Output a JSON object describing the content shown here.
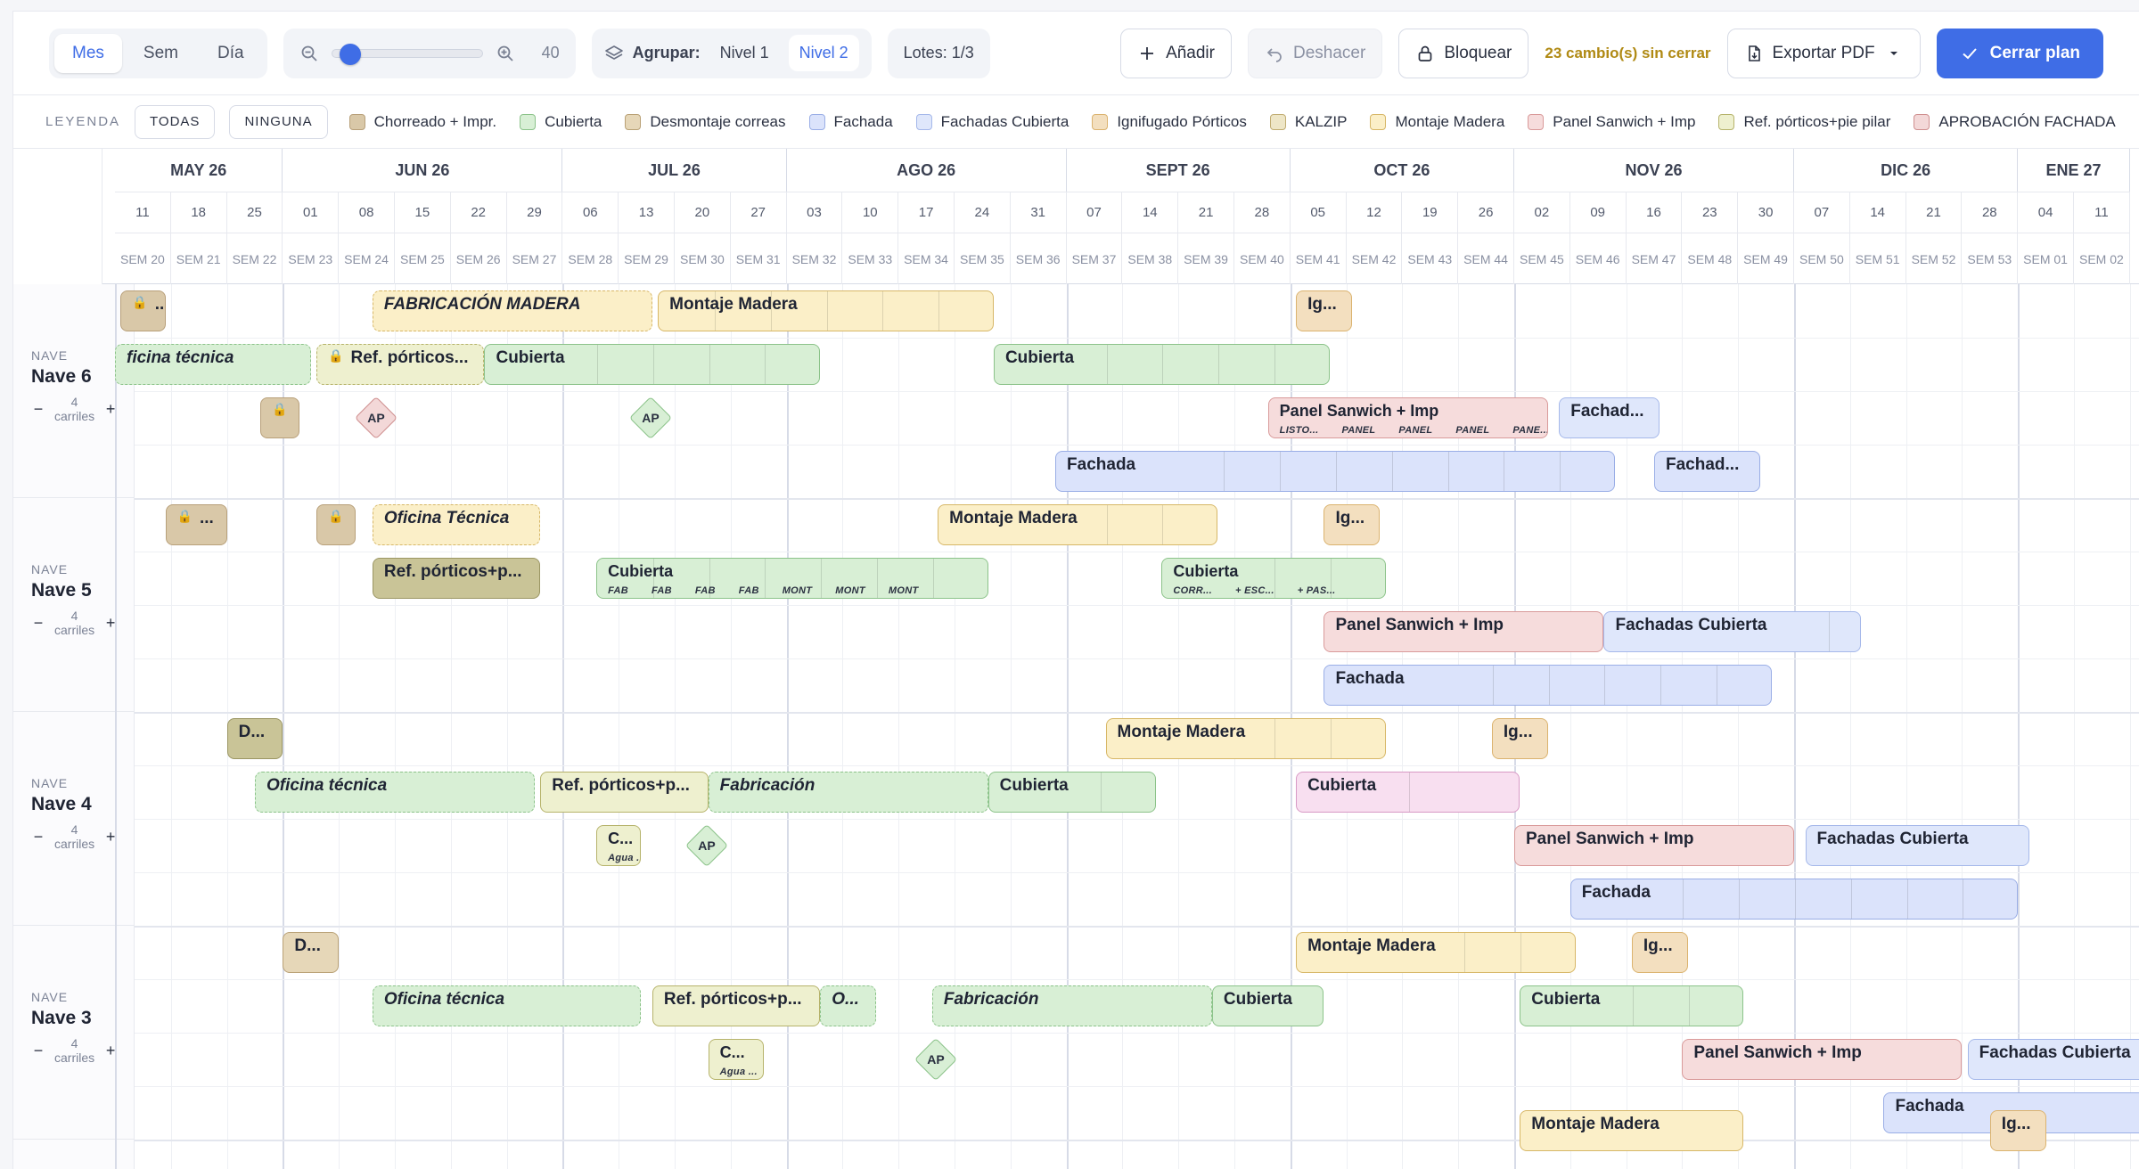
{
  "toolbar": {
    "view_modes": [
      {
        "label": "Mes",
        "active": true
      },
      {
        "label": "Sem",
        "active": false
      },
      {
        "label": "Día",
        "active": false
      }
    ],
    "zoom_value": "40",
    "zoom_level_fraction": 0.05,
    "group_label": "Agrupar:",
    "group_levels": [
      {
        "label": "Nivel 1",
        "active": false
      },
      {
        "label": "Nivel 2",
        "active": true
      }
    ],
    "lotes_label": "Lotes: 1/3",
    "add_label": "Añadir",
    "undo_label": "Deshacer",
    "lock_label": "Bloquear",
    "unsaved_text": "23 cambio(s) sin cerrar",
    "export_label": "Exportar PDF",
    "close_plan_label": "Cerrar plan"
  },
  "legend": {
    "title": "LEYENDA",
    "all_label": "TODAS",
    "none_label": "NINGUNA",
    "items": [
      {
        "label": "Chorreado + Impr.",
        "color": "#d9c8a8",
        "border": "#b8a07a"
      },
      {
        "label": "Cubierta",
        "color": "#d8efd5",
        "border": "#8cc38a"
      },
      {
        "label": "Desmontaje correas",
        "color": "#e6d7b8",
        "border": "#b9a176"
      },
      {
        "label": "Fachada",
        "color": "#dbe3fb",
        "border": "#9aaee6"
      },
      {
        "label": "Fachadas Cubierta",
        "color": "#dfe7fb",
        "border": "#a5b8ea"
      },
      {
        "label": "Ignifugado Pórticos",
        "color": "#f3dfbf",
        "border": "#dbb36f"
      },
      {
        "label": "KALZIP",
        "color": "#eee6c7",
        "border": "#c1ad72"
      },
      {
        "label": "Montaje Madera",
        "color": "#fbefc8",
        "border": "#d7b767"
      },
      {
        "label": "Panel Sanwich + Imp",
        "color": "#f6dcdc",
        "border": "#d99a9a"
      },
      {
        "label": "Ref. pórticos+pie pilar",
        "color": "#eef0cf",
        "border": "#b6b36b"
      },
      {
        "label": "APROBACIÓN FACHADA",
        "color": "#f3d8d8",
        "border": "#cf8f8f"
      }
    ]
  },
  "timeline": {
    "months": [
      "MAY 26",
      "JUN 26",
      "JUL 26",
      "AGO 26",
      "SEPT 26",
      "OCT 26",
      "NOV 26",
      "DIC 26",
      "ENE 27"
    ],
    "days": [
      "11",
      "18",
      "25",
      "01",
      "08",
      "15",
      "22",
      "29",
      "06",
      "13",
      "20",
      "27",
      "03",
      "10",
      "17",
      "24",
      "31",
      "07",
      "14",
      "21",
      "28",
      "05",
      "12",
      "19",
      "26",
      "02",
      "09",
      "16",
      "23",
      "30",
      "07",
      "14",
      "21",
      "28",
      "04",
      "11"
    ],
    "weeks": [
      "SEM 20",
      "SEM 21",
      "SEM 22",
      "SEM 23",
      "SEM 24",
      "SEM 25",
      "SEM 26",
      "SEM 27",
      "SEM 28",
      "SEM 29",
      "SEM 30",
      "SEM 31",
      "SEM 32",
      "SEM 33",
      "SEM 34",
      "SEM 35",
      "SEM 36",
      "SEM 37",
      "SEM 38",
      "SEM 39",
      "SEM 40",
      "SEM 41",
      "SEM 42",
      "SEM 43",
      "SEM 44",
      "SEM 45",
      "SEM 46",
      "SEM 47",
      "SEM 48",
      "SEM 49",
      "SEM 50",
      "SEM 51",
      "SEM 52",
      "SEM 53",
      "SEM 01",
      "SEM 02"
    ]
  },
  "naves": [
    {
      "kicker": "NAVE",
      "name": "Nave 6",
      "lanes_count": "4",
      "lanes_label": "carriles"
    },
    {
      "kicker": "NAVE",
      "name": "Nave 5",
      "lanes_count": "4",
      "lanes_label": "carriles"
    },
    {
      "kicker": "NAVE",
      "name": "Nave 4",
      "lanes_count": "4",
      "lanes_label": "carriles"
    },
    {
      "kicker": "NAVE",
      "name": "Nave 3",
      "lanes_count": "4",
      "lanes_label": "carriles"
    }
  ],
  "bars": [
    {
      "nave": 0,
      "lane": 0,
      "start": 0.1,
      "weeks": 0.8,
      "label": "...",
      "type": "Chorreado + Impr.",
      "locked": true
    },
    {
      "nave": 0,
      "lane": 0,
      "start": 4.6,
      "weeks": 5.0,
      "label": "FABRICACIÓN MADERA",
      "type": "Montaje Madera",
      "italic": true,
      "dashed": true
    },
    {
      "nave": 0,
      "lane": 0,
      "start": 9.7,
      "weeks": 6.0,
      "label": "Montaje Madera",
      "type": "Montaje Madera",
      "segments": [
        1,
        2,
        3,
        4,
        5
      ]
    },
    {
      "nave": 0,
      "lane": 0,
      "start": 21.1,
      "weeks": 1.0,
      "label": "Ig...",
      "type": "Ignifugado Pórticos"
    },
    {
      "nave": 0,
      "lane": 1,
      "start": 0.0,
      "weeks": 3.5,
      "label": "ficina técnica",
      "type": "Cubierta",
      "italic": true,
      "dashed": true
    },
    {
      "nave": 0,
      "lane": 1,
      "start": 3.6,
      "weeks": 3.0,
      "label": "Ref. pórticos...",
      "type": "Ref. pórticos+pie pilar",
      "locked": true,
      "dashed": true
    },
    {
      "nave": 0,
      "lane": 1,
      "start": 6.6,
      "weeks": 6.0,
      "label": "Cubierta",
      "type": "Cubierta",
      "segments": [
        2,
        3,
        4,
        5
      ]
    },
    {
      "nave": 0,
      "lane": 1,
      "start": 15.7,
      "weeks": 6.0,
      "label": "Cubierta",
      "type": "Cubierta",
      "segments": [
        2,
        3,
        4,
        5
      ]
    },
    {
      "nave": 0,
      "lane": 2,
      "start": 2.6,
      "weeks": 0.7,
      "label": "",
      "type": "Chorreado + Impr.",
      "locked": true
    },
    {
      "nave": 0,
      "lane": 2,
      "start": 20.6,
      "weeks": 5.0,
      "label": "Panel Sanwich + Imp",
      "type": "Panel Sanwich + Imp",
      "subs": [
        "LISTO...",
        "PANEL",
        "PANEL",
        "PANEL",
        "PANE..."
      ]
    },
    {
      "nave": 0,
      "lane": 2,
      "start": 25.8,
      "weeks": 1.8,
      "label": "Fachad...",
      "type": "Fachadas Cubierta"
    },
    {
      "nave": 0,
      "lane": 3,
      "start": 16.8,
      "weeks": 10.0,
      "label": "Fachada",
      "type": "Fachada",
      "segments": [
        3,
        4,
        5,
        6,
        7,
        8,
        9
      ]
    },
    {
      "nave": 0,
      "lane": 3,
      "start": 27.5,
      "weeks": 1.9,
      "label": "Fachad...",
      "type": "Fachada"
    },
    {
      "nave": 1,
      "lane": 0,
      "start": 0.9,
      "weeks": 1.1,
      "label": "...",
      "type": "Chorreado + Impr.",
      "locked": true
    },
    {
      "nave": 1,
      "lane": 0,
      "start": 3.6,
      "weeks": 0.7,
      "label": "",
      "type": "Chorreado + Impr.",
      "locked": true
    },
    {
      "nave": 1,
      "lane": 0,
      "start": 4.6,
      "weeks": 3.0,
      "label": "Oficina Técnica",
      "type": "Montaje Madera",
      "italic": true,
      "dashed": true
    },
    {
      "nave": 1,
      "lane": 0,
      "start": 14.7,
      "weeks": 5.0,
      "label": "Montaje Madera",
      "type": "Montaje Madera",
      "segments": [
        3,
        4
      ]
    },
    {
      "nave": 1,
      "lane": 0,
      "start": 21.6,
      "weeks": 1.0,
      "label": "Ig...",
      "type": "Ignifugado Pórticos"
    },
    {
      "nave": 1,
      "lane": 1,
      "start": 4.6,
      "weeks": 3.0,
      "label": "Ref. pórticos+p...",
      "type": "Ref. pórticos+pie pilar",
      "dark": true
    },
    {
      "nave": 1,
      "lane": 1,
      "start": 8.6,
      "weeks": 7.0,
      "label": "Cubierta",
      "type": "Cubierta",
      "subs": [
        "FAB",
        "FAB",
        "FAB",
        "FAB",
        "MONT",
        "MONT",
        "MONT"
      ],
      "segments": [
        1,
        2,
        3,
        4,
        5,
        6
      ]
    },
    {
      "nave": 1,
      "lane": 1,
      "start": 18.7,
      "weeks": 4.0,
      "label": "Cubierta",
      "type": "Cubierta",
      "subs": [
        "CORR...",
        "+ ESC...",
        "+ PAS..."
      ],
      "segments": [
        2,
        3
      ]
    },
    {
      "nave": 1,
      "lane": 2,
      "start": 21.6,
      "weeks": 5.0,
      "label": "Panel Sanwich + Imp",
      "type": "Panel Sanwich + Imp"
    },
    {
      "nave": 1,
      "lane": 2,
      "start": 26.6,
      "weeks": 4.6,
      "label": "Fachadas Cubierta",
      "type": "Fachadas Cubierta",
      "segments": [
        4
      ]
    },
    {
      "nave": 1,
      "lane": 3,
      "start": 21.6,
      "weeks": 8.0,
      "label": "Fachada",
      "type": "Fachada",
      "segments": [
        3,
        4,
        5,
        6,
        7
      ]
    },
    {
      "nave": 2,
      "lane": 0,
      "start": 2.0,
      "weeks": 1.0,
      "label": "D...",
      "type": "Desmontaje correas",
      "dark": true
    },
    {
      "nave": 2,
      "lane": 0,
      "start": 17.7,
      "weeks": 5.0,
      "label": "Montaje Madera",
      "type": "Montaje Madera",
      "segments": [
        3,
        4
      ]
    },
    {
      "nave": 2,
      "lane": 0,
      "start": 24.6,
      "weeks": 1.0,
      "label": "Ig...",
      "type": "Ignifugado Pórticos"
    },
    {
      "nave": 2,
      "lane": 1,
      "start": 2.5,
      "weeks": 5.0,
      "label": "Oficina técnica",
      "type": "Cubierta",
      "italic": true,
      "dashed": true
    },
    {
      "nave": 2,
      "lane": 1,
      "start": 7.6,
      "weeks": 3.0,
      "label": "Ref. pórticos+p...",
      "type": "Ref. pórticos+pie pilar"
    },
    {
      "nave": 2,
      "lane": 1,
      "start": 10.6,
      "weeks": 5.0,
      "label": "Fabricación",
      "type": "Cubierta",
      "italic": true,
      "dashed": true
    },
    {
      "nave": 2,
      "lane": 1,
      "start": 15.6,
      "weeks": 3.0,
      "label": "Cubierta",
      "type": "Cubierta",
      "segments": [
        2
      ]
    },
    {
      "nave": 2,
      "lane": 1,
      "start": 21.1,
      "weeks": 4.0,
      "label": "Cubierta",
      "type": "Panel Sanwich + Imp",
      "pink": true,
      "segments": [
        2
      ]
    },
    {
      "nave": 2,
      "lane": 2,
      "start": 8.6,
      "weeks": 0.8,
      "label": "C...",
      "type": "Ref. pórticos+pie pilar",
      "subs": [
        "Agua ..."
      ]
    },
    {
      "nave": 2,
      "lane": 2,
      "start": 25.0,
      "weeks": 5.0,
      "label": "Panel Sanwich + Imp",
      "type": "Panel Sanwich + Imp"
    },
    {
      "nave": 2,
      "lane": 2,
      "start": 30.2,
      "weeks": 4.0,
      "label": "Fachadas Cubierta",
      "type": "Fachadas Cubierta"
    },
    {
      "nave": 2,
      "lane": 3,
      "start": 26.0,
      "weeks": 8.0,
      "label": "Fachada",
      "type": "Fachada",
      "segments": [
        2,
        3,
        4,
        5,
        6,
        7
      ]
    },
    {
      "nave": 3,
      "lane": 0,
      "start": 3.0,
      "weeks": 1.0,
      "label": "D...",
      "type": "Desmontaje correas"
    },
    {
      "nave": 3,
      "lane": 0,
      "start": 21.1,
      "weeks": 5.0,
      "label": "Montaje Madera",
      "type": "Montaje Madera",
      "segments": [
        3,
        4
      ]
    },
    {
      "nave": 3,
      "lane": 0,
      "start": 27.1,
      "weeks": 1.0,
      "label": "Ig...",
      "type": "Ignifugado Pórticos"
    },
    {
      "nave": 3,
      "lane": 1,
      "start": 4.6,
      "weeks": 4.8,
      "label": "Oficina técnica",
      "type": "Cubierta",
      "italic": true,
      "dashed": true
    },
    {
      "nave": 3,
      "lane": 1,
      "start": 9.6,
      "weeks": 3.0,
      "label": "Ref. pórticos+p...",
      "type": "Ref. pórticos+pie pilar"
    },
    {
      "nave": 3,
      "lane": 1,
      "start": 12.6,
      "weeks": 1.0,
      "label": "O...",
      "type": "Cubierta",
      "italic": true,
      "dashed": true
    },
    {
      "nave": 3,
      "lane": 1,
      "start": 14.6,
      "weeks": 5.0,
      "label": "Fabricación",
      "type": "Cubierta",
      "italic": true,
      "dashed": true
    },
    {
      "nave": 3,
      "lane": 1,
      "start": 19.6,
      "weeks": 2.0,
      "label": "Cubierta",
      "type": "Cubierta"
    },
    {
      "nave": 3,
      "lane": 1,
      "start": 25.1,
      "weeks": 4.0,
      "label": "Cubierta",
      "type": "Cubierta",
      "segments": [
        2,
        3
      ]
    },
    {
      "nave": 3,
      "lane": 2,
      "start": 10.6,
      "weeks": 1.0,
      "label": "C...",
      "type": "Ref. pórticos+pie pilar",
      "subs": [
        "Agua ..."
      ]
    },
    {
      "nave": 3,
      "lane": 2,
      "start": 28.0,
      "weeks": 5.0,
      "label": "Panel Sanwich + Imp",
      "type": "Panel Sanwich + Imp"
    },
    {
      "nave": 3,
      "lane": 2,
      "start": 33.1,
      "weeks": 3.4,
      "label": "Fachadas Cubierta",
      "type": "Fachadas Cubierta"
    },
    {
      "nave": 3,
      "lane": 3,
      "start": 31.6,
      "weeks": 5.0,
      "label": "Fachada",
      "type": "Fachada"
    },
    {
      "nave": 3,
      "lane": 4,
      "start": 25.1,
      "weeks": 4.0,
      "label": "Montaje Madera",
      "type": "Montaje Madera"
    },
    {
      "nave": 3,
      "lane": 4,
      "start": 33.5,
      "weeks": 1.0,
      "label": "Ig...",
      "type": "Ignifugado Pórticos"
    }
  ],
  "milestones": [
    {
      "nave": 0,
      "lane": 2,
      "week": 4.4,
      "label": "AP",
      "color": "#f3d8d8",
      "border": "#cf8f8f"
    },
    {
      "nave": 0,
      "lane": 2,
      "week": 9.3,
      "label": "AP",
      "color": "#d8efd5",
      "border": "#8cc38a"
    },
    {
      "nave": 2,
      "lane": 2,
      "week": 10.3,
      "label": "AP",
      "color": "#d8efd5",
      "border": "#8cc38a"
    },
    {
      "nave": 3,
      "lane": 2,
      "week": 14.4,
      "label": "AP",
      "color": "#d8efd5",
      "border": "#8cc38a"
    }
  ]
}
